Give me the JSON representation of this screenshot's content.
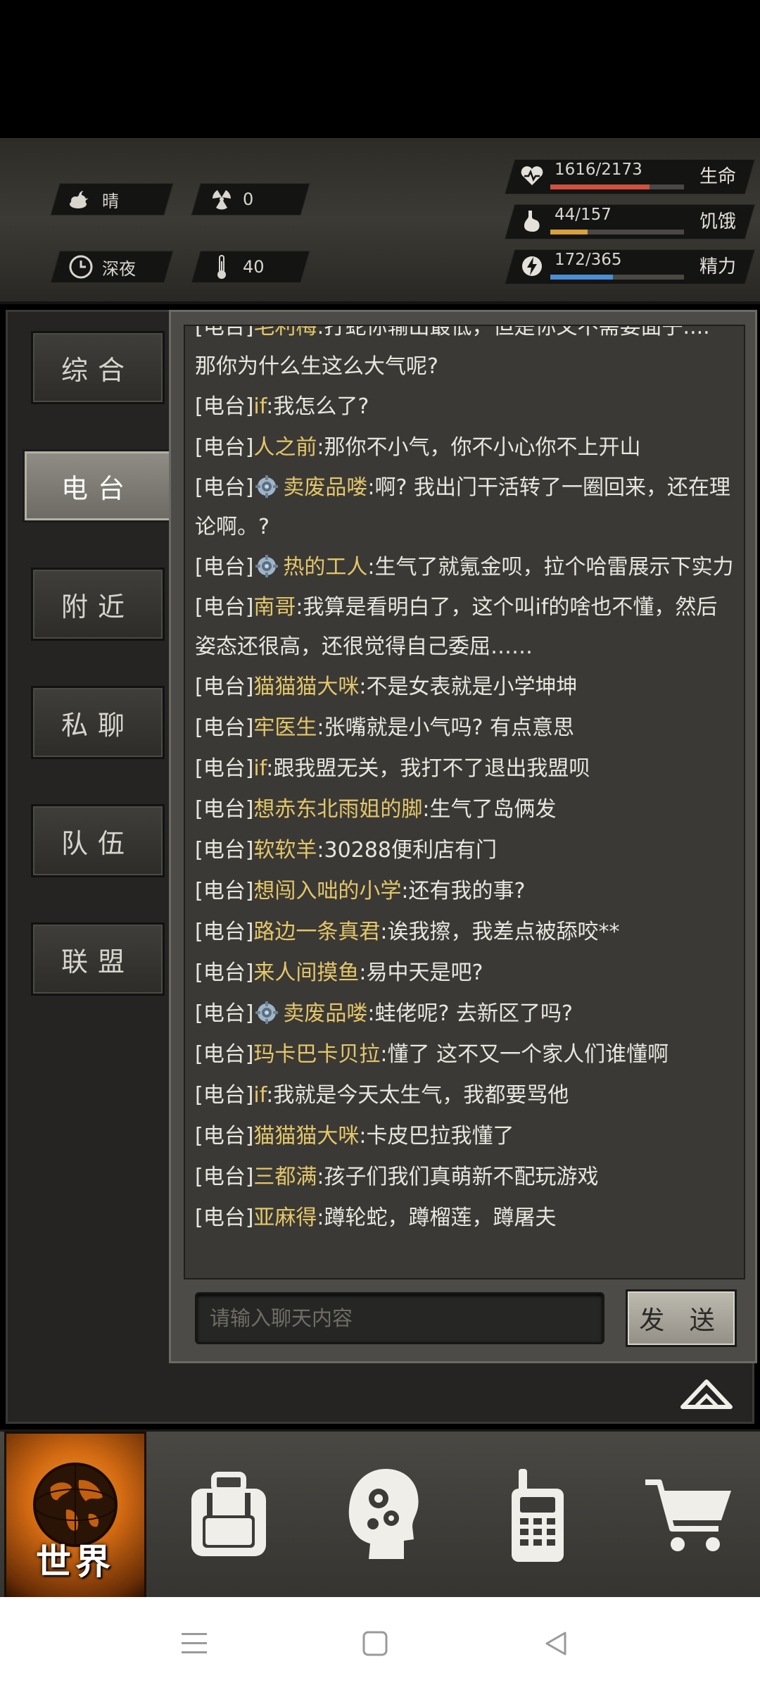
{
  "status": {
    "weather": {
      "icon": "cloudy-moon-icon",
      "label": "晴"
    },
    "radiation": {
      "icon": "radiation-icon",
      "value": "0"
    },
    "time": {
      "icon": "clock-icon",
      "label": "深夜"
    },
    "temperature": {
      "icon": "thermometer-icon",
      "value": "40"
    },
    "body": {
      "icon": "body-figure-icon",
      "plus": "plus-icon",
      "minus": "minus-icon"
    },
    "bars": {
      "health": {
        "icon": "heart-icon",
        "text": "1616/2173",
        "label": "生命",
        "fraction": 0.744,
        "color": "#d2503f"
      },
      "hunger": {
        "icon": "stomach-icon",
        "text": "44/157",
        "label": "饥饿",
        "fraction": 0.28,
        "color": "#d8a23a"
      },
      "energy": {
        "icon": "energy-icon",
        "text": "172/365",
        "label": "精力",
        "fraction": 0.471,
        "color": "#4a8fd6"
      }
    }
  },
  "tabs": [
    "综合",
    "电台",
    "附近",
    "私聊",
    "队伍",
    "联盟"
  ],
  "active_tab": "电台",
  "chat": {
    "messages": [
      {
        "tag": "[电台]",
        "nick": "毛利梅",
        "text": ":打蛇你输出最低，但是你又不需要面子.... 那你为什么生这么大气呢?",
        "gear": false
      },
      {
        "tag": "[电台]",
        "nick": "if",
        "text": ":我怎么了?",
        "gear": false
      },
      {
        "tag": "[电台]",
        "nick": "人之前",
        "text": ":那你不小气，你不小心你不上开山",
        "gear": false
      },
      {
        "tag": "[电台]",
        "nick": "卖废品喽",
        "text": ":啊? 我出门干活转了一圈回来，还在理论啊。?",
        "gear": true
      },
      {
        "tag": "[电台]",
        "nick": "热的工人",
        "text": ":生气了就氪金呗，拉个哈雷展示下实力",
        "gear": true
      },
      {
        "tag": "[电台]",
        "nick": "南哥",
        "text": ":我算是看明白了，这个叫if的啥也不懂，然后姿态还很高，还很觉得自己委屈……",
        "gear": false
      },
      {
        "tag": "[电台]",
        "nick": "猫猫猫大咪",
        "text": ":不是女表就是小学坤坤",
        "gear": false
      },
      {
        "tag": "[电台]",
        "nick": "牢医生",
        "text": ":张嘴就是小气吗? 有点意思",
        "gear": false
      },
      {
        "tag": "[电台]",
        "nick": "if",
        "text": ":跟我盟无关，我打不了退出我盟呗",
        "gear": false
      },
      {
        "tag": "[电台]",
        "nick": "想赤东北雨姐的脚",
        "text": ":生气了岛俩发",
        "gear": false
      },
      {
        "tag": "[电台]",
        "nick": "软软羊",
        "text": ":30288便利店有门",
        "gear": false
      },
      {
        "tag": "[电台]",
        "nick": "想闯入咄的小学",
        "text": ":还有我的事?",
        "gear": false
      },
      {
        "tag": "[电台]",
        "nick": "路边一条真君",
        "text": ":诶我擦，我差点被舔咬**",
        "gear": false
      },
      {
        "tag": "[电台]",
        "nick": "来人间摸鱼",
        "text": ":易中天是吧?",
        "gear": false
      },
      {
        "tag": "[电台]",
        "nick": "卖废品喽",
        "text": ":蛙佬呢? 去新区了吗?",
        "gear": true
      },
      {
        "tag": "[电台]",
        "nick": "玛卡巴卡贝拉",
        "text": ":懂了 这不又一个家人们谁懂啊",
        "gear": false
      },
      {
        "tag": "[电台]",
        "nick": "if",
        "text": ":我就是今天太生气，我都要骂他",
        "gear": false
      },
      {
        "tag": "[电台]",
        "nick": "猫猫猫大咪",
        "text": ":卡皮巴拉我懂了",
        "gear": false
      },
      {
        "tag": "[电台]",
        "nick": "三都满",
        "text": ":孩子们我们真萌新不配玩游戏",
        "gear": false
      },
      {
        "tag": "[电台]",
        "nick": "亚麻得",
        "text": ":蹲轮蛇，蹲榴莲，蹲屠夫",
        "gear": false
      }
    ],
    "input_placeholder": "请输入聊天内容",
    "send_label": "发 送"
  },
  "collapse_icon": "chevron-up-icon",
  "bottom_nav": [
    {
      "name": "world",
      "label": "世界",
      "icon": "globe-icon",
      "active": true
    },
    {
      "name": "backpack",
      "label": "",
      "icon": "backpack-icon",
      "active": false
    },
    {
      "name": "skills",
      "label": "",
      "icon": "brain-gears-icon",
      "active": false
    },
    {
      "name": "radio",
      "label": "",
      "icon": "walkie-talkie-icon",
      "active": false
    },
    {
      "name": "shop",
      "label": "",
      "icon": "cart-icon",
      "active": false
    }
  ],
  "system_nav": [
    "menu-icon",
    "home-icon",
    "back-icon"
  ]
}
